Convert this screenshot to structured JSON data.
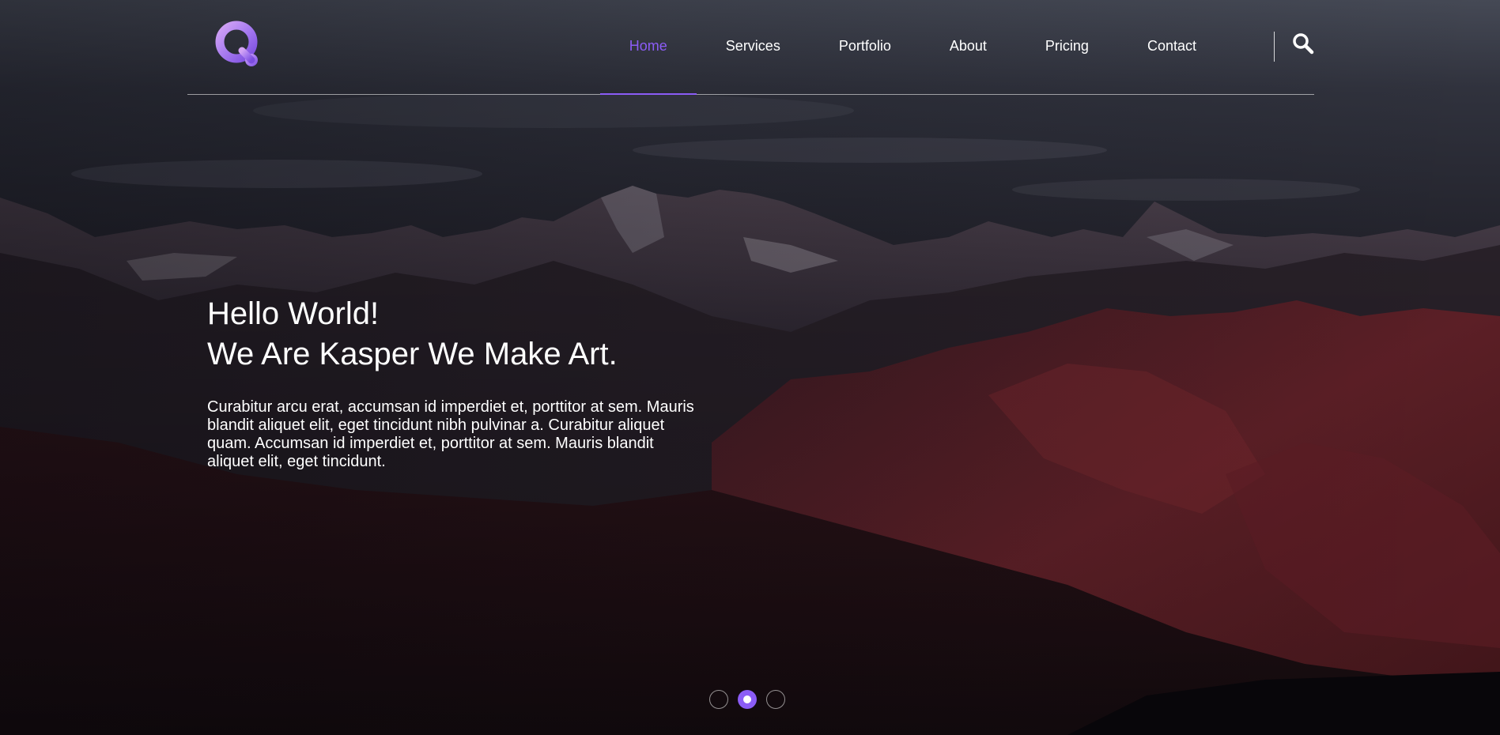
{
  "brand": {
    "logo_icon": "q-logo-icon",
    "accent_color": "#8b5cf6"
  },
  "nav": {
    "items": [
      {
        "label": "Home",
        "active": true
      },
      {
        "label": "Services",
        "active": false
      },
      {
        "label": "Portfolio",
        "active": false
      },
      {
        "label": "About",
        "active": false
      },
      {
        "label": "Pricing",
        "active": false
      },
      {
        "label": "Contact",
        "active": false
      }
    ],
    "search_icon": "search-icon"
  },
  "hero": {
    "title_line1": "Hello World!",
    "title_line2": "We Are Kasper We Make Art.",
    "description": "Curabitur arcu erat, accumsan id imperdiet et, porttitor at sem. Mauris blandit aliquet elit, eget tincidunt nibh pulvinar a. Curabitur aliquet quam. Accumsan id imperdiet et, porttitor at sem. Mauris blandit aliquet elit, eget tincidunt."
  },
  "slider": {
    "count": 3,
    "active_index": 1
  }
}
